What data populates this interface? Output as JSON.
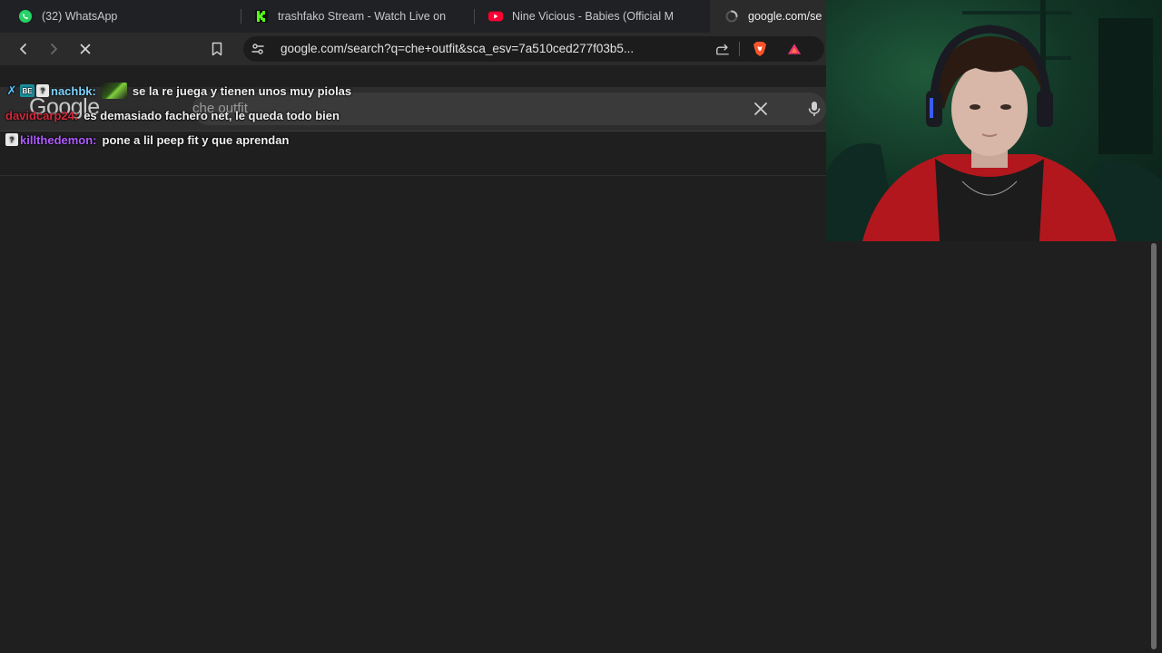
{
  "browser": {
    "tabs": [
      {
        "title": "(32) WhatsApp",
        "icon": "whatsapp-icon",
        "color": "#25d366"
      },
      {
        "title": "trashfako Stream - Watch Live on",
        "icon": "kick-icon",
        "color": "#53fc18"
      },
      {
        "title": "Nine Vicious - Babies (Official M",
        "icon": "youtube-icon",
        "color": "#ff0033"
      },
      {
        "title": "google.com/se",
        "icon": "loading-spinner-icon",
        "color": "#bdbdbd",
        "active": true
      }
    ],
    "url": "google.com/search?q=che+outfit&sca_esv=7a510ced277f03b5..."
  },
  "google": {
    "logo": "Google",
    "query": "che outfit"
  },
  "chat": [
    {
      "username": "nachbk:",
      "user_color": "#7fd4ff",
      "text": "se la re juega y tienen unos muy piolas",
      "has_emote": true
    },
    {
      "username": "davidcarp24:",
      "user_color": "#d2283a",
      "text": "es demasiado fachero net, le queda todo bien",
      "has_emote": false
    },
    {
      "username": "killthedemon:",
      "user_color": "#b05bff",
      "text": "pone a lil peep fit y que aprendan",
      "has_emote": false
    }
  ],
  "colors": {
    "accent": "#8ab4f8",
    "brave": "#fb542b"
  }
}
